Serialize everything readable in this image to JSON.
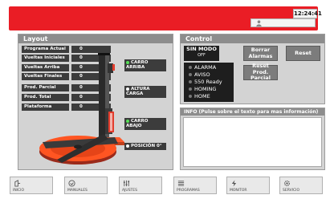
{
  "header": {
    "clock": "12:24:41",
    "colors": {
      "bar": "#ea1d25"
    }
  },
  "layout": {
    "title": "Layout",
    "rows": [
      {
        "label": "Programa Actual",
        "value": "0"
      },
      {
        "label": "Vueltas Iniciales",
        "value": "0"
      },
      {
        "label": "Vueltas Arriba",
        "value": "0"
      },
      {
        "label": "Vueltas Finales",
        "value": "0"
      },
      {
        "label": "Prod. Parcial",
        "value": "0"
      },
      {
        "label": "Prod. Total",
        "value": "0"
      },
      {
        "label": "Plataforma",
        "value": "0",
        "unit": "°"
      }
    ],
    "carro_arriba": "CARRO ARRIBA",
    "altura_carga": "ALTURA CARGA",
    "carro_abajo": "CARRO ABAJO",
    "posicion": "POSICIÓN 0°"
  },
  "control": {
    "title": "Control",
    "mode": {
      "title": "SIN MODO",
      "value": "OFF"
    },
    "borrar_alarmas": "Borrar Alarmas",
    "reset": "Reset",
    "reset_prod": "Reset Prod. Parcial",
    "status": [
      "ALARMA",
      "AVISO",
      "550 Ready",
      "HOMING",
      "HOME"
    ]
  },
  "info": {
    "title": "INFO (Pulse sobre el texto para mas información)"
  },
  "nav": [
    {
      "label": "INICIO",
      "icon": "home-icon"
    },
    {
      "label": "MANUALES",
      "icon": "manual-icon"
    },
    {
      "label": "AJUSTES",
      "icon": "sliders-icon"
    },
    {
      "label": "PROGRAMAS",
      "icon": "list-icon"
    },
    {
      "label": "MONITOR",
      "icon": "bolt-icon"
    },
    {
      "label": "SERVICIO",
      "icon": "gear-icon"
    }
  ]
}
